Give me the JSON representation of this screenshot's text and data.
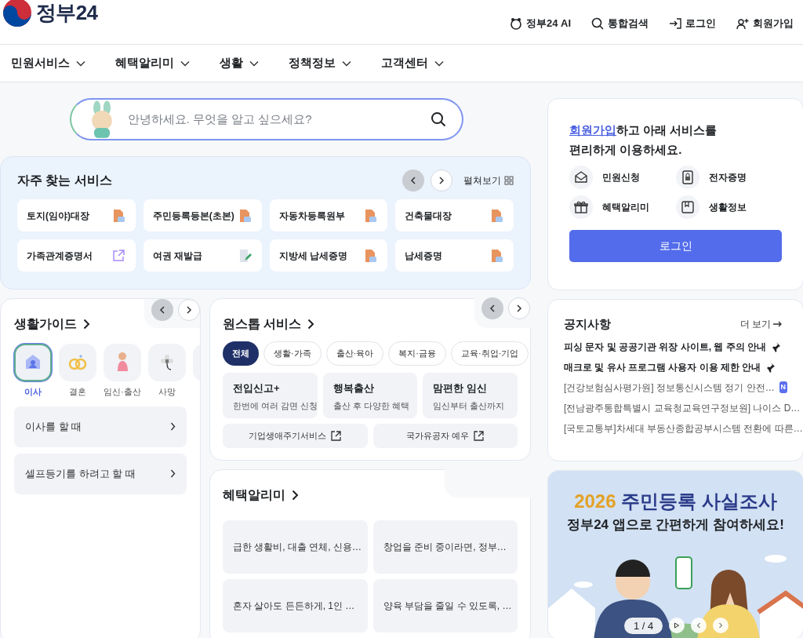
{
  "header": {
    "logo_text": "정부24",
    "links": [
      {
        "label": "정부24 AI",
        "kind": "ai"
      },
      {
        "label": "통합검색",
        "kind": "search"
      },
      {
        "label": "로그인",
        "kind": "login"
      },
      {
        "label": "회원가입",
        "kind": "signup"
      }
    ]
  },
  "nav": [
    "민원서비스",
    "혜택알리미",
    "생활",
    "정책정보",
    "고객센터"
  ],
  "search": {
    "placeholder": "안녕하세요. 무엇을 알고 싶으세요?"
  },
  "frequent": {
    "title": "자주 찾는 서비스",
    "expand_label": "펼쳐보기",
    "prev_disabled": true,
    "items": [
      {
        "label": "토지(임야)대장",
        "kind": "document"
      },
      {
        "label": "주민등록등본(초본)",
        "kind": "document"
      },
      {
        "label": "자동차등록원부",
        "kind": "document"
      },
      {
        "label": "건축물대장",
        "kind": "document"
      },
      {
        "label": "가족관계증명서",
        "kind": "external"
      },
      {
        "label": "여권 재발급",
        "kind": "edit"
      },
      {
        "label": "지방세 납세증명",
        "kind": "document"
      },
      {
        "label": "납세증명",
        "kind": "document"
      }
    ]
  },
  "life_guide": {
    "title": "생활가이드",
    "prev_disabled": true,
    "categories": [
      {
        "label": "이사",
        "kind": "house",
        "selected": true
      },
      {
        "label": "결혼",
        "kind": "rings",
        "selected": false
      },
      {
        "label": "임신·출산",
        "kind": "pregnancy",
        "selected": false
      },
      {
        "label": "사망",
        "kind": "flower",
        "selected": false
      },
      {
        "kind": "partial"
      }
    ],
    "topics": [
      "이사를 할 때",
      "셀프등기를 하려고 할 때"
    ]
  },
  "onestop": {
    "title": "원스톱 서비스",
    "prev_disabled": true,
    "filters": [
      {
        "label": "전체",
        "selected": true
      },
      {
        "label": "생활·가족",
        "selected": false
      },
      {
        "label": "출산·육아",
        "selected": false
      },
      {
        "label": "복지·금융",
        "selected": false
      },
      {
        "label": "교육·취업·기업",
        "selected": false
      }
    ],
    "cards": [
      {
        "title": "전입신고+",
        "subtitle": "한번에 여러 감면 신청"
      },
      {
        "title": "행복출산",
        "subtitle": "출산 후 다양한 혜택"
      },
      {
        "title": "맘편한 임신",
        "subtitle": "임신부터 출산까지"
      }
    ],
    "links": [
      "기업생애주기서비스",
      "국가유공자 예우"
    ]
  },
  "benefits": {
    "title": "혜택알리미",
    "items": [
      "급한 생활비, 대출 연체, 신용…",
      "창업을 준비 중이라면, 정부…",
      "혼자 살아도 든든하게, 1인 …",
      "양육 부담을 줄일 수 있도록, …"
    ]
  },
  "login_box": {
    "signup_link": "회원가입",
    "prompt_rest": "하고 아래 서비스를",
    "prompt_line2": "편리하게 이용하세요.",
    "services": [
      {
        "label": "민원신청",
        "kind": "mail"
      },
      {
        "label": "전자증명",
        "kind": "certificate"
      },
      {
        "label": "혜택알리미",
        "kind": "gift"
      },
      {
        "label": "생활정보",
        "kind": "bookmark"
      }
    ],
    "button": "로그인"
  },
  "notices": {
    "title": "공지사항",
    "more": "더 보기",
    "items": [
      {
        "text": "피싱 문자 및 공공기관 위장 사이트, 웹 주의 안내",
        "pinned": true
      },
      {
        "text": "매크로 및 유사 프로그램 사용자 이용 제한 안내",
        "pinned": true
      },
      {
        "text": "[건강보험심사평가원] 정보통신시스템 정기 안전…",
        "pinned": false,
        "badge": "N"
      },
      {
        "text": "[전남광주통합특별시 교육청교육연구정보원] 나이스 D…",
        "pinned": false
      },
      {
        "text": "[국토교통부]차세대 부동산종합공부시스템 전환에 따른…",
        "pinned": false
      }
    ]
  },
  "banner": {
    "kind": "picture",
    "year": "2026",
    "headline": "주민등록 사실조사",
    "subline": "정부24 앱으로 간편하게 참여하세요!",
    "pager": "1 / 4"
  }
}
